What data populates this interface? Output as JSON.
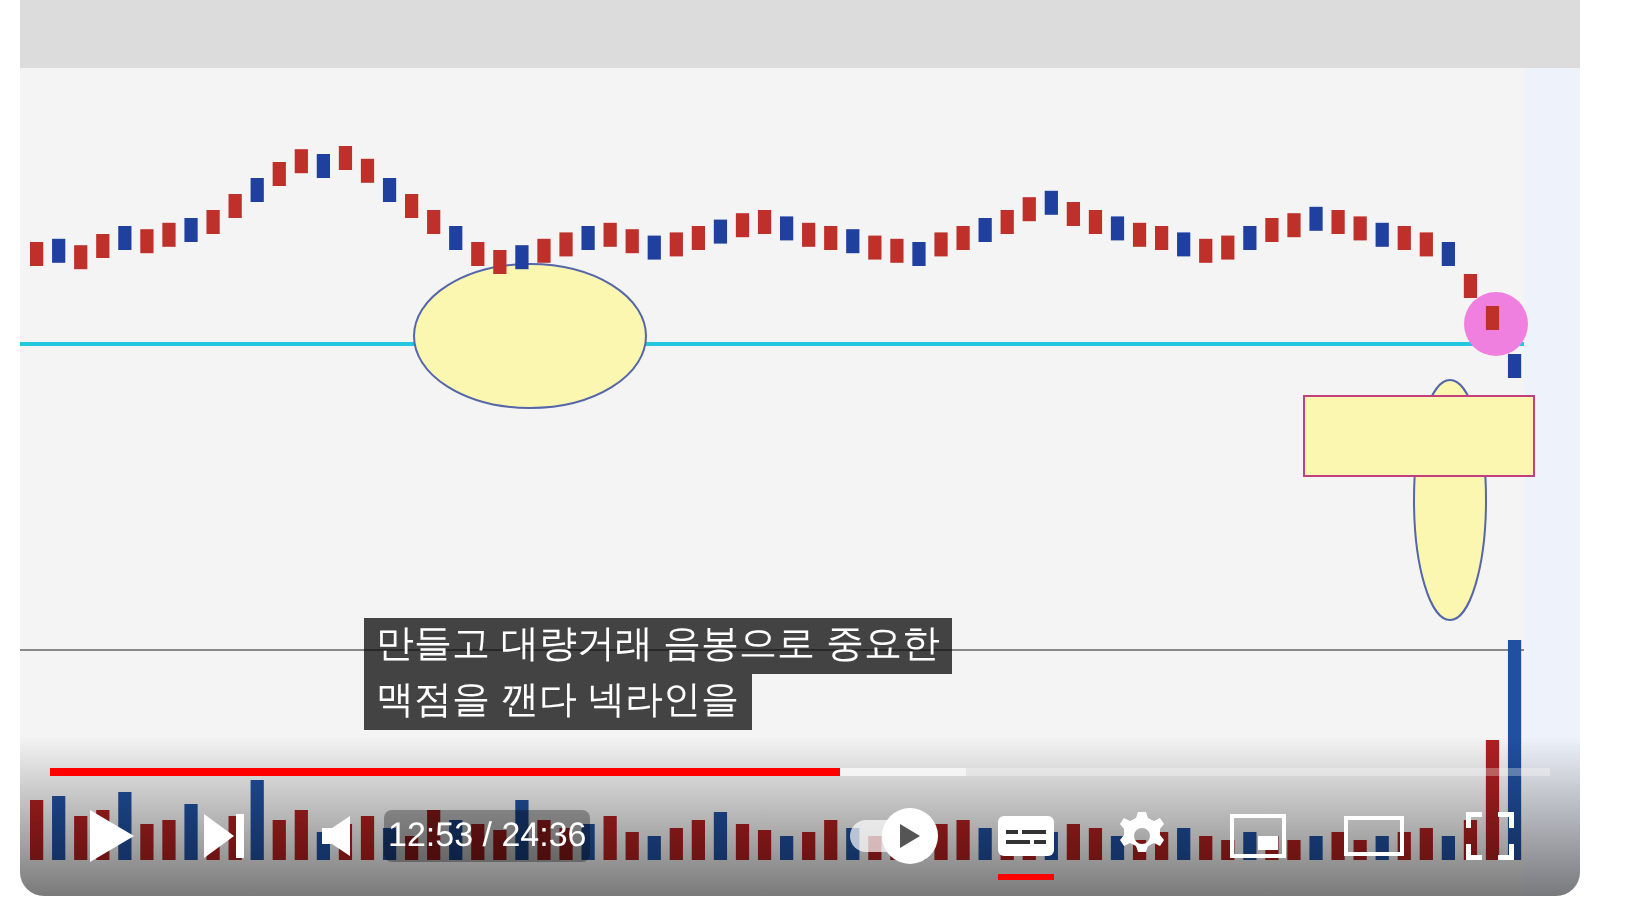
{
  "player": {
    "subtitles": [
      "만들고 대량거래 음봉으로 중요한",
      "맥점을 깬다 넥라인을"
    ],
    "buffer": {
      "level": 0.61
    },
    "progress": {
      "level": 0.527
    },
    "time": "12:53 / 24:36",
    "autoplay_on": true,
    "captions_on": true
  }
}
